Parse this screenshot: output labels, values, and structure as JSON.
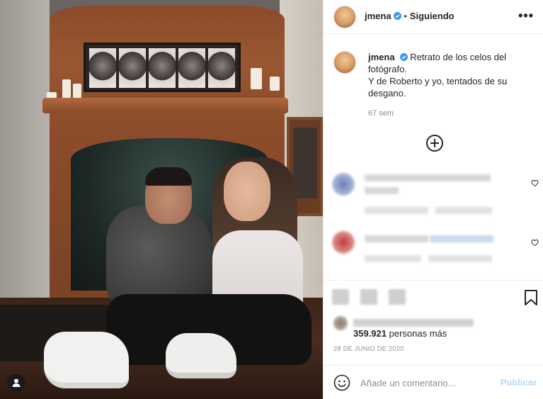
{
  "post": {
    "username": "jmena",
    "follow_status": "Siguiendo",
    "separator": "•",
    "more_label": "•••",
    "caption_line1": "Retrato de los celos del",
    "caption_line2": "fotógrafo.",
    "caption_line3": "Y de Roberto y yo, tentados de su",
    "caption_line4": "desgano.",
    "caption_time": "67 sem",
    "likes_count": "359.921",
    "likes_suffix": " personas más",
    "date": "28 DE JUNIO DE 2020"
  },
  "comment_box": {
    "placeholder": "Añade un comentario...",
    "publish_label": "Publicar"
  },
  "icons": {
    "verified": "verified-badge-icon",
    "more": "more-options-icon",
    "load_more": "plus-circle-icon",
    "like": "heart-icon",
    "save": "bookmark-icon",
    "emoji": "emoji-icon",
    "tag": "user-tag-icon"
  },
  "colors": {
    "verified": "#3897f0",
    "publish_disabled": "#b3dbff",
    "secondary_text": "#8e8e8e"
  }
}
